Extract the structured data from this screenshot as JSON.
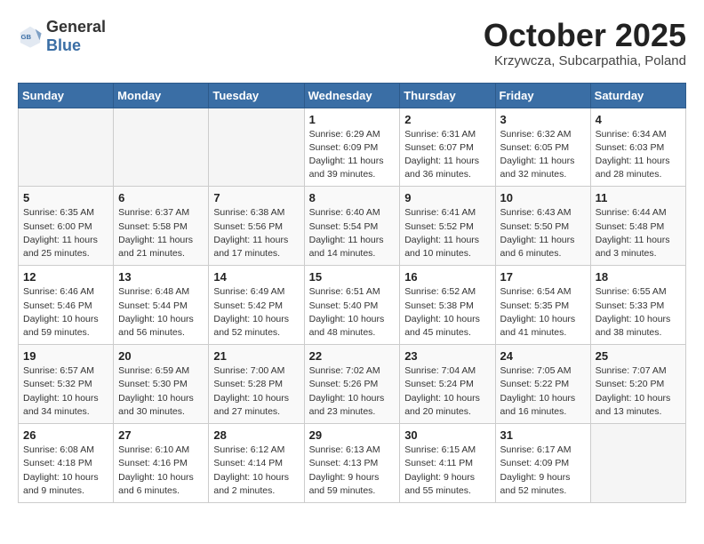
{
  "header": {
    "logo_general": "General",
    "logo_blue": "Blue",
    "month_title": "October 2025",
    "location": "Krzywcza, Subcarpathia, Poland"
  },
  "weekdays": [
    "Sunday",
    "Monday",
    "Tuesday",
    "Wednesday",
    "Thursday",
    "Friday",
    "Saturday"
  ],
  "weeks": [
    [
      {
        "day": "",
        "info": ""
      },
      {
        "day": "",
        "info": ""
      },
      {
        "day": "",
        "info": ""
      },
      {
        "day": "1",
        "info": "Sunrise: 6:29 AM\nSunset: 6:09 PM\nDaylight: 11 hours\nand 39 minutes."
      },
      {
        "day": "2",
        "info": "Sunrise: 6:31 AM\nSunset: 6:07 PM\nDaylight: 11 hours\nand 36 minutes."
      },
      {
        "day": "3",
        "info": "Sunrise: 6:32 AM\nSunset: 6:05 PM\nDaylight: 11 hours\nand 32 minutes."
      },
      {
        "day": "4",
        "info": "Sunrise: 6:34 AM\nSunset: 6:03 PM\nDaylight: 11 hours\nand 28 minutes."
      }
    ],
    [
      {
        "day": "5",
        "info": "Sunrise: 6:35 AM\nSunset: 6:00 PM\nDaylight: 11 hours\nand 25 minutes."
      },
      {
        "day": "6",
        "info": "Sunrise: 6:37 AM\nSunset: 5:58 PM\nDaylight: 11 hours\nand 21 minutes."
      },
      {
        "day": "7",
        "info": "Sunrise: 6:38 AM\nSunset: 5:56 PM\nDaylight: 11 hours\nand 17 minutes."
      },
      {
        "day": "8",
        "info": "Sunrise: 6:40 AM\nSunset: 5:54 PM\nDaylight: 11 hours\nand 14 minutes."
      },
      {
        "day": "9",
        "info": "Sunrise: 6:41 AM\nSunset: 5:52 PM\nDaylight: 11 hours\nand 10 minutes."
      },
      {
        "day": "10",
        "info": "Sunrise: 6:43 AM\nSunset: 5:50 PM\nDaylight: 11 hours\nand 6 minutes."
      },
      {
        "day": "11",
        "info": "Sunrise: 6:44 AM\nSunset: 5:48 PM\nDaylight: 11 hours\nand 3 minutes."
      }
    ],
    [
      {
        "day": "12",
        "info": "Sunrise: 6:46 AM\nSunset: 5:46 PM\nDaylight: 10 hours\nand 59 minutes."
      },
      {
        "day": "13",
        "info": "Sunrise: 6:48 AM\nSunset: 5:44 PM\nDaylight: 10 hours\nand 56 minutes."
      },
      {
        "day": "14",
        "info": "Sunrise: 6:49 AM\nSunset: 5:42 PM\nDaylight: 10 hours\nand 52 minutes."
      },
      {
        "day": "15",
        "info": "Sunrise: 6:51 AM\nSunset: 5:40 PM\nDaylight: 10 hours\nand 48 minutes."
      },
      {
        "day": "16",
        "info": "Sunrise: 6:52 AM\nSunset: 5:38 PM\nDaylight: 10 hours\nand 45 minutes."
      },
      {
        "day": "17",
        "info": "Sunrise: 6:54 AM\nSunset: 5:35 PM\nDaylight: 10 hours\nand 41 minutes."
      },
      {
        "day": "18",
        "info": "Sunrise: 6:55 AM\nSunset: 5:33 PM\nDaylight: 10 hours\nand 38 minutes."
      }
    ],
    [
      {
        "day": "19",
        "info": "Sunrise: 6:57 AM\nSunset: 5:32 PM\nDaylight: 10 hours\nand 34 minutes."
      },
      {
        "day": "20",
        "info": "Sunrise: 6:59 AM\nSunset: 5:30 PM\nDaylight: 10 hours\nand 30 minutes."
      },
      {
        "day": "21",
        "info": "Sunrise: 7:00 AM\nSunset: 5:28 PM\nDaylight: 10 hours\nand 27 minutes."
      },
      {
        "day": "22",
        "info": "Sunrise: 7:02 AM\nSunset: 5:26 PM\nDaylight: 10 hours\nand 23 minutes."
      },
      {
        "day": "23",
        "info": "Sunrise: 7:04 AM\nSunset: 5:24 PM\nDaylight: 10 hours\nand 20 minutes."
      },
      {
        "day": "24",
        "info": "Sunrise: 7:05 AM\nSunset: 5:22 PM\nDaylight: 10 hours\nand 16 minutes."
      },
      {
        "day": "25",
        "info": "Sunrise: 7:07 AM\nSunset: 5:20 PM\nDaylight: 10 hours\nand 13 minutes."
      }
    ],
    [
      {
        "day": "26",
        "info": "Sunrise: 6:08 AM\nSunset: 4:18 PM\nDaylight: 10 hours\nand 9 minutes."
      },
      {
        "day": "27",
        "info": "Sunrise: 6:10 AM\nSunset: 4:16 PM\nDaylight: 10 hours\nand 6 minutes."
      },
      {
        "day": "28",
        "info": "Sunrise: 6:12 AM\nSunset: 4:14 PM\nDaylight: 10 hours\nand 2 minutes."
      },
      {
        "day": "29",
        "info": "Sunrise: 6:13 AM\nSunset: 4:13 PM\nDaylight: 9 hours\nand 59 minutes."
      },
      {
        "day": "30",
        "info": "Sunrise: 6:15 AM\nSunset: 4:11 PM\nDaylight: 9 hours\nand 55 minutes."
      },
      {
        "day": "31",
        "info": "Sunrise: 6:17 AM\nSunset: 4:09 PM\nDaylight: 9 hours\nand 52 minutes."
      },
      {
        "day": "",
        "info": ""
      }
    ]
  ]
}
